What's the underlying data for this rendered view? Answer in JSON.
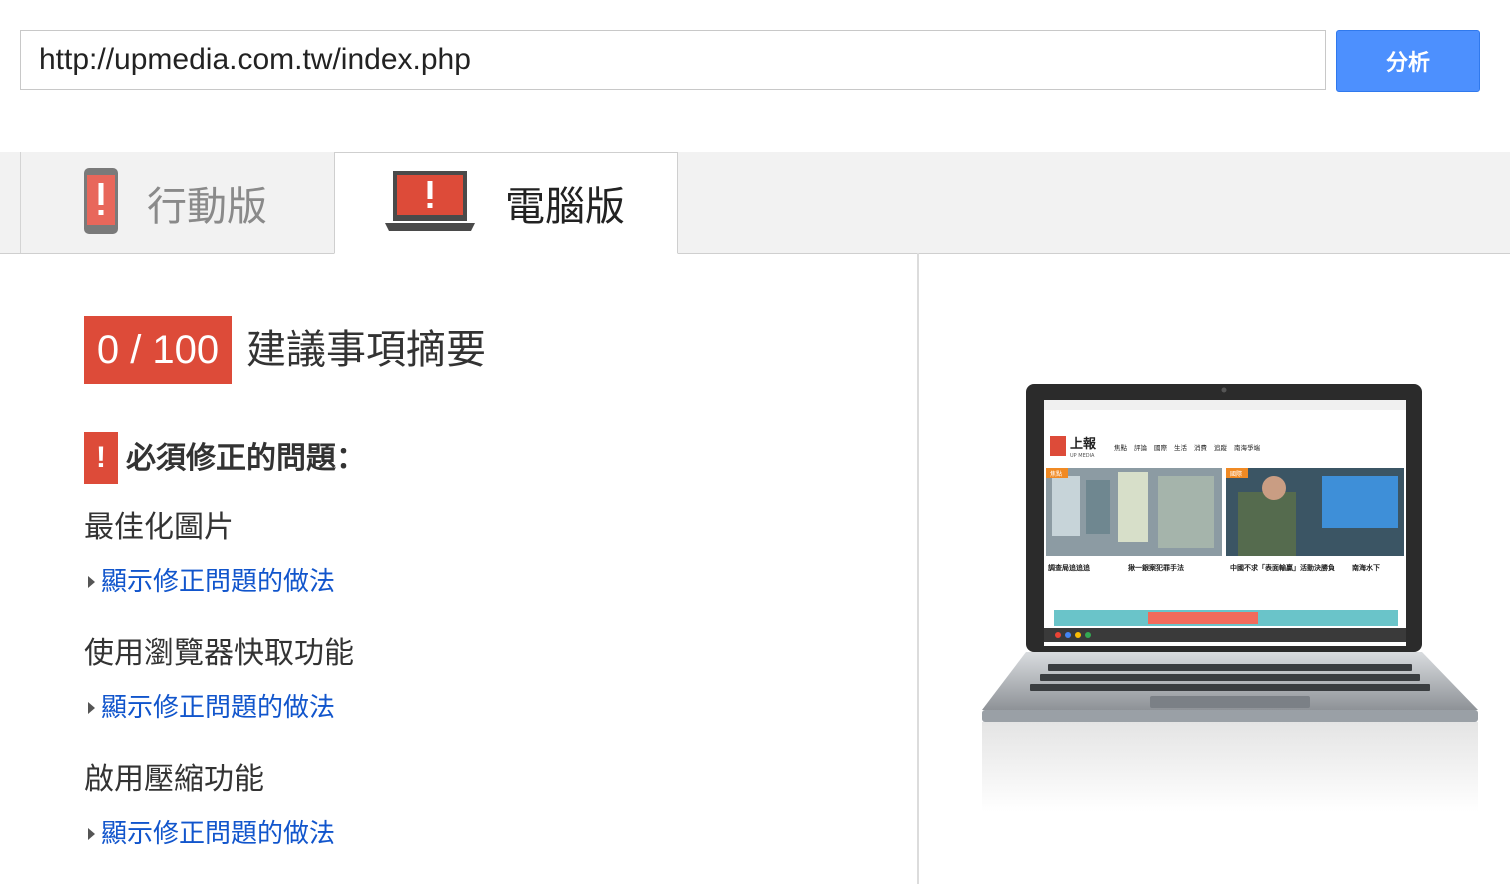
{
  "url_bar": {
    "value": "http://upmedia.com.tw/index.php",
    "analyze_label": "分析"
  },
  "tabs": [
    {
      "label": "行動版",
      "icon": "phone-icon",
      "active": false
    },
    {
      "label": "電腦版",
      "icon": "laptop-icon",
      "active": true
    }
  ],
  "summary": {
    "score": "0 / 100",
    "title": "建議事項摘要",
    "must_fix_title": "必須修正的問題："
  },
  "rules": [
    {
      "name": "最佳化圖片",
      "link": "顯示修正問題的做法"
    },
    {
      "name": "使用瀏覽器快取功能",
      "link": "顯示修正問題的做法"
    },
    {
      "name": "啟用壓縮功能",
      "link": "顯示修正問題的做法"
    }
  ],
  "colors": {
    "accent": "#4d90fe",
    "error": "#dd4b39",
    "link": "#1155cc"
  },
  "preview": {
    "site_logo": "上報",
    "site_logo_sub": "UP MEDIA",
    "nav": [
      "焦點",
      "評論",
      "國際",
      "生活",
      "消費",
      "追蹤",
      "南海爭端"
    ],
    "headlines": [
      "調查局追追追",
      "揪一銀案犯罪手法",
      "中國不求「表面輸贏」活動決勝負",
      "南海水下"
    ],
    "tags": [
      "焦點",
      "國際"
    ]
  }
}
